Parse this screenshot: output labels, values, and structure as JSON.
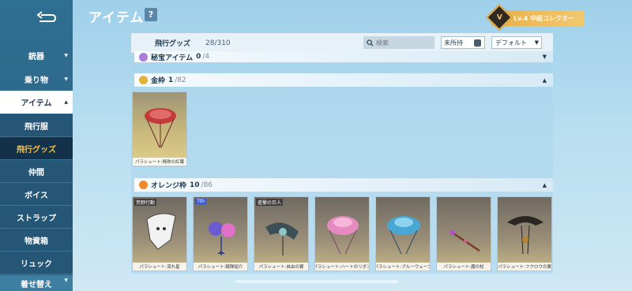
{
  "header": {
    "title": "アイテム",
    "help_label": "?",
    "collector_badge": "Lv.4 中級コレクター",
    "collector_icon": "V"
  },
  "sidebar": {
    "items": [
      {
        "label": "銃器",
        "chevron": "▼"
      },
      {
        "label": "乗り物",
        "chevron": "▼"
      },
      {
        "label": "アイテム",
        "chevron": "▲"
      },
      {
        "label": "飛行服"
      },
      {
        "label": "飛行グッズ"
      },
      {
        "label": "仲間"
      },
      {
        "label": "ボイス"
      },
      {
        "label": "ストラップ"
      },
      {
        "label": "物資箱"
      },
      {
        "label": "リュック"
      },
      {
        "label": "着せ替え",
        "chevron": "▼"
      }
    ]
  },
  "toolbar": {
    "category": "飛行グッズ",
    "count": "28/310",
    "search_placeholder": "検索",
    "unowned_label": "未所持",
    "sort_label": "デフォルト"
  },
  "sections": [
    {
      "name": "秘宝アイテム",
      "owned": "0",
      "total": "/4",
      "color": "#a77fd6",
      "toggle": "▼"
    },
    {
      "name": "金枠",
      "owned": "1",
      "total": "/82",
      "color": "#e3b23c",
      "toggle": "▲"
    },
    {
      "name": "オレンジ枠",
      "owned": "10",
      "total": "/86",
      "color": "#ef8a2e",
      "toggle": "▲"
    }
  ],
  "gold_items": [
    {
      "caption": "パラシュート:情熱の紅葉"
    }
  ],
  "orange_items": [
    {
      "caption": "パラシュート:流れ星",
      "tag": "荒野行動"
    },
    {
      "caption": "パラシュート:戦隊紹介",
      "tag": "7th"
    },
    {
      "caption": "パラシュート:自由の翼",
      "tag": "進撃の巨人"
    },
    {
      "caption": "パラシュート:ハートのリボン",
      "tag": ""
    },
    {
      "caption": "パラシュート:ブルーウェーブ",
      "tag": ""
    },
    {
      "caption": "パラシュート:魔の杖",
      "tag": ""
    },
    {
      "caption": "パラシュート:フクロウの翼",
      "tag": ""
    }
  ]
}
